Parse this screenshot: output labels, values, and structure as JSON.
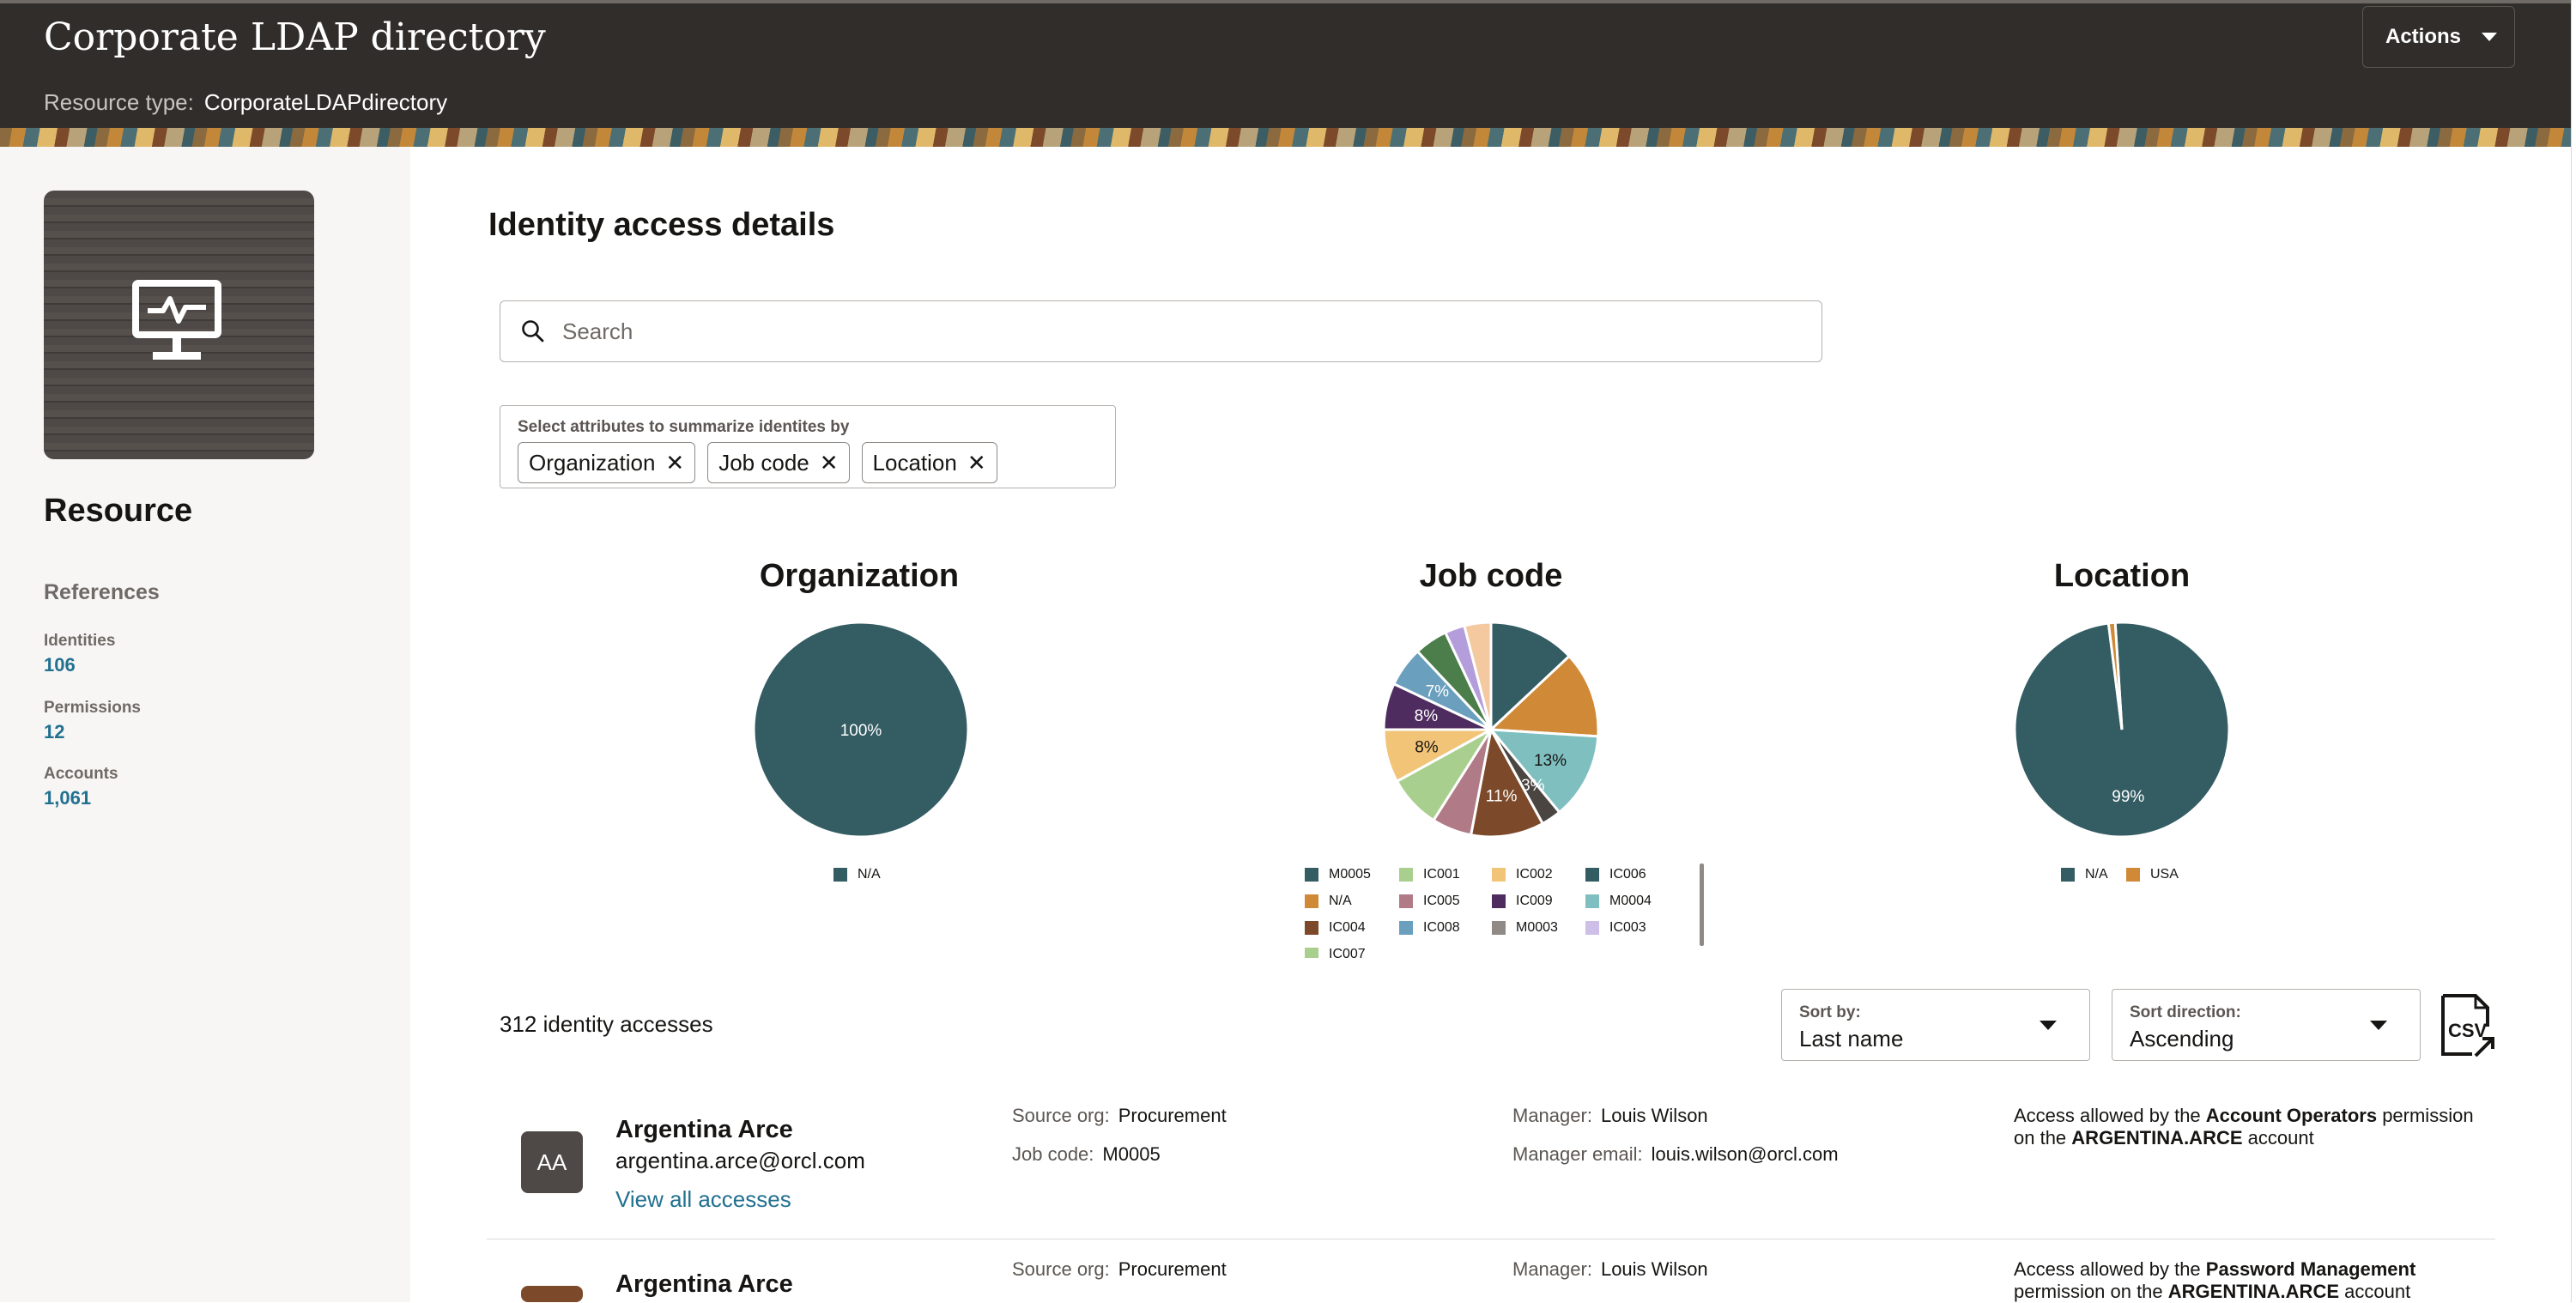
{
  "header": {
    "title": "Corporate LDAP directory",
    "resource_type_label": "Resource type:",
    "resource_type_value": "CorporateLDAPdirectory",
    "actions_label": "Actions"
  },
  "left": {
    "heading": "Resource",
    "references_heading": "References",
    "references": [
      {
        "label": "Identities",
        "value": "106"
      },
      {
        "label": "Permissions",
        "value": "12"
      },
      {
        "label": "Accounts",
        "value": "1,061"
      }
    ]
  },
  "main": {
    "title": "Identity access details",
    "search_placeholder": "Search",
    "attr_label": "Select attributes to summarize identites by",
    "chips": [
      "Organization",
      "Job code",
      "Location"
    ]
  },
  "chart_data": [
    {
      "type": "pie",
      "title": "Organization",
      "categories": [
        "N/A"
      ],
      "values": [
        100
      ],
      "labels": [
        "100%"
      ],
      "colors": [
        "#335c63"
      ]
    },
    {
      "type": "pie",
      "title": "Job code",
      "categories": [
        "M0005",
        "N/A",
        "M0004",
        "IC006",
        "IC004",
        "IC005",
        "IC001",
        "IC002",
        "IC009",
        "IC008",
        "IC007",
        "IC003",
        "M0003"
      ],
      "values": [
        13,
        13,
        13,
        3,
        11,
        6,
        8,
        8,
        7,
        6,
        5,
        3,
        4
      ],
      "labels_shown": {
        "M0004": "13%",
        "IC006": "13%",
        "IC004": "11%",
        "IC009": "8%",
        "IC002": "8%",
        "IC008": "7%"
      },
      "colors": [
        "#335c63",
        "#d08936",
        "#7fbfbf",
        "#4a4541",
        "#7c4a2a",
        "#b07a86",
        "#a8cf8e",
        "#f2c478",
        "#4f2c5f",
        "#6a9fbd",
        "#4b7e4a",
        "#b49ddb",
        "#f4c9a0"
      ]
    },
    {
      "type": "pie",
      "title": "Location",
      "categories": [
        "N/A",
        "USA"
      ],
      "values": [
        99,
        1
      ],
      "labels": [
        "99%"
      ],
      "colors": [
        "#335c63",
        "#d08936"
      ]
    }
  ],
  "legends": {
    "organization": [
      {
        "name": "N/A",
        "color": "#335c63"
      }
    ],
    "job_code": [
      {
        "name": "M0005",
        "color": "#335c63"
      },
      {
        "name": "IC001",
        "color": "#a8cf8e"
      },
      {
        "name": "IC002",
        "color": "#f2c478"
      },
      {
        "name": "IC006",
        "color": "#335c63"
      },
      {
        "name": "N/A",
        "color": "#d08936"
      },
      {
        "name": "IC005",
        "color": "#b07a86"
      },
      {
        "name": "IC009",
        "color": "#4f2c5f"
      },
      {
        "name": "M0004",
        "color": "#7fbfbf"
      },
      {
        "name": "IC004",
        "color": "#7c4a2a"
      },
      {
        "name": "IC008",
        "color": "#6a9fbd"
      },
      {
        "name": "M0003",
        "color": "#8f8a86"
      },
      {
        "name": "IC003",
        "color": "#cdbfe8"
      },
      {
        "name": "IC007",
        "color": "#a8cf8e"
      }
    ],
    "location": [
      {
        "name": "N/A",
        "color": "#335c63"
      },
      {
        "name": "USA",
        "color": "#d08936"
      }
    ]
  },
  "results": {
    "count": "312 identity accesses",
    "sort_by_label": "Sort by:",
    "sort_by_value": "Last name",
    "sort_dir_label": "Sort direction:",
    "sort_dir_value": "Ascending",
    "csv_label": "CSV"
  },
  "rows": [
    {
      "initials": "AA",
      "name": "Argentina Arce",
      "email": "argentina.arce@orcl.com",
      "view_link": "View all accesses",
      "source_org_label": "Source org:",
      "source_org": "Procurement",
      "job_code_label": "Job code:",
      "job_code": "M0005",
      "manager_label": "Manager:",
      "manager": "Louis Wilson",
      "manager_email_label": "Manager email:",
      "manager_email": "louis.wilson@orcl.com",
      "access_pre": "Access allowed by the",
      "permission": "Account Operators",
      "access_mid": "permission on the",
      "account": "ARGENTINA.ARCE",
      "access_post": "account"
    },
    {
      "name": "Argentina Arce",
      "source_org_label": "Source org:",
      "source_org": "Procurement",
      "manager_label": "Manager:",
      "manager": "Louis Wilson",
      "access_pre": "Access allowed by the",
      "permission": "Password Management",
      "access_mid": "permission on the",
      "account": "ARGENTINA.ARCE",
      "access_post": "account"
    }
  ]
}
